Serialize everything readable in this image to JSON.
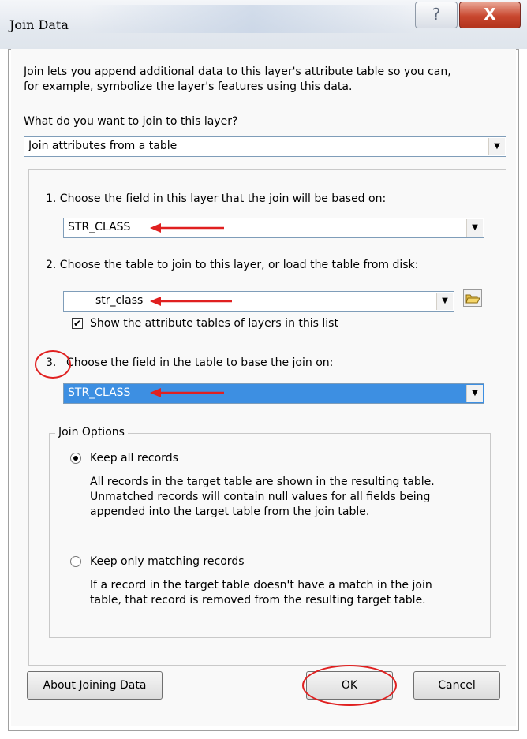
{
  "window": {
    "title": "Join Data",
    "help_label": "?",
    "close_label": "X"
  },
  "intro": {
    "line1": "Join lets you append additional data to this layer's attribute table so you can,",
    "line2": "for example, symbolize the layer's features using this data."
  },
  "join_question": "What do you want to join to this layer?",
  "join_type": {
    "value": "Join attributes from a table"
  },
  "step1": {
    "label": "1.  Choose the field in this layer that the join will be based on:",
    "value": "STR_CLASS"
  },
  "step2": {
    "label": "2.  Choose the table to join to this layer, or load the table from disk:",
    "value": "str_class",
    "show_tables_label": "Show the attribute tables of layers in this list",
    "show_tables_checked": true
  },
  "step3": {
    "number": "3.",
    "label": "Choose the field in the table to base the join on:",
    "value": "STR_CLASS"
  },
  "join_options": {
    "legend": "Join Options",
    "keep_all": {
      "label": "Keep all records",
      "selected": true,
      "desc1": "All records in the target table are shown in the resulting table.",
      "desc2": "Unmatched records will contain null values for all fields being",
      "desc3": "appended into the target table from the join table."
    },
    "keep_matching": {
      "label": "Keep only matching records",
      "selected": false,
      "desc1": "If a record in the target table doesn't have a match in the join",
      "desc2": "table, that record is removed from the resulting target table."
    }
  },
  "buttons": {
    "about": "About Joining Data",
    "ok": "OK",
    "cancel": "Cancel"
  },
  "colors": {
    "annotation_red": "#e02020",
    "selection_blue": "#3d8fe2"
  }
}
